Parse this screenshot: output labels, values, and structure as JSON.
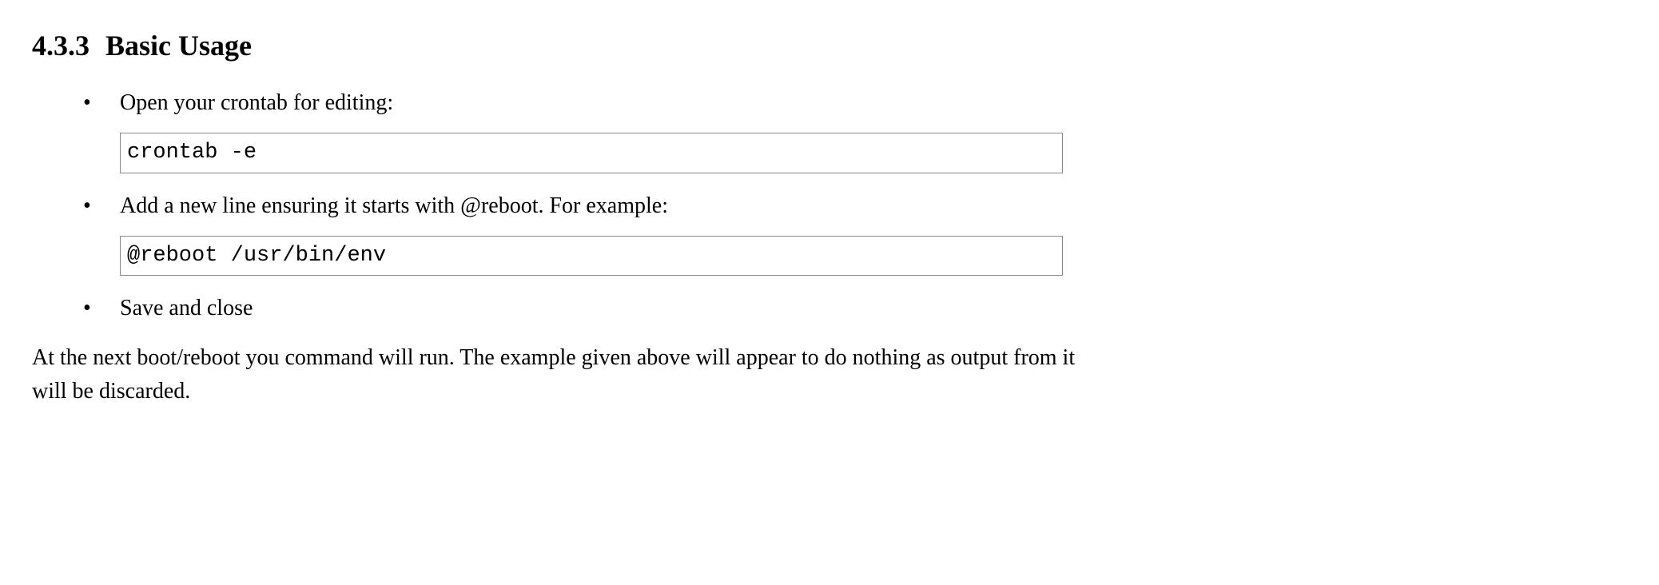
{
  "section": {
    "number": "4.3.3",
    "title": "Basic Usage"
  },
  "bullets": [
    {
      "text": "Open your crontab for editing:",
      "code": "crontab -e"
    },
    {
      "text": "Add a new line ensuring it starts with @reboot. For example:",
      "code": "@reboot /usr/bin/env"
    },
    {
      "text": "Save and close",
      "code": null
    }
  ],
  "paragraph": "At the next boot/reboot you command will run. The example given above will appear to do nothing as output from it will be discarded."
}
